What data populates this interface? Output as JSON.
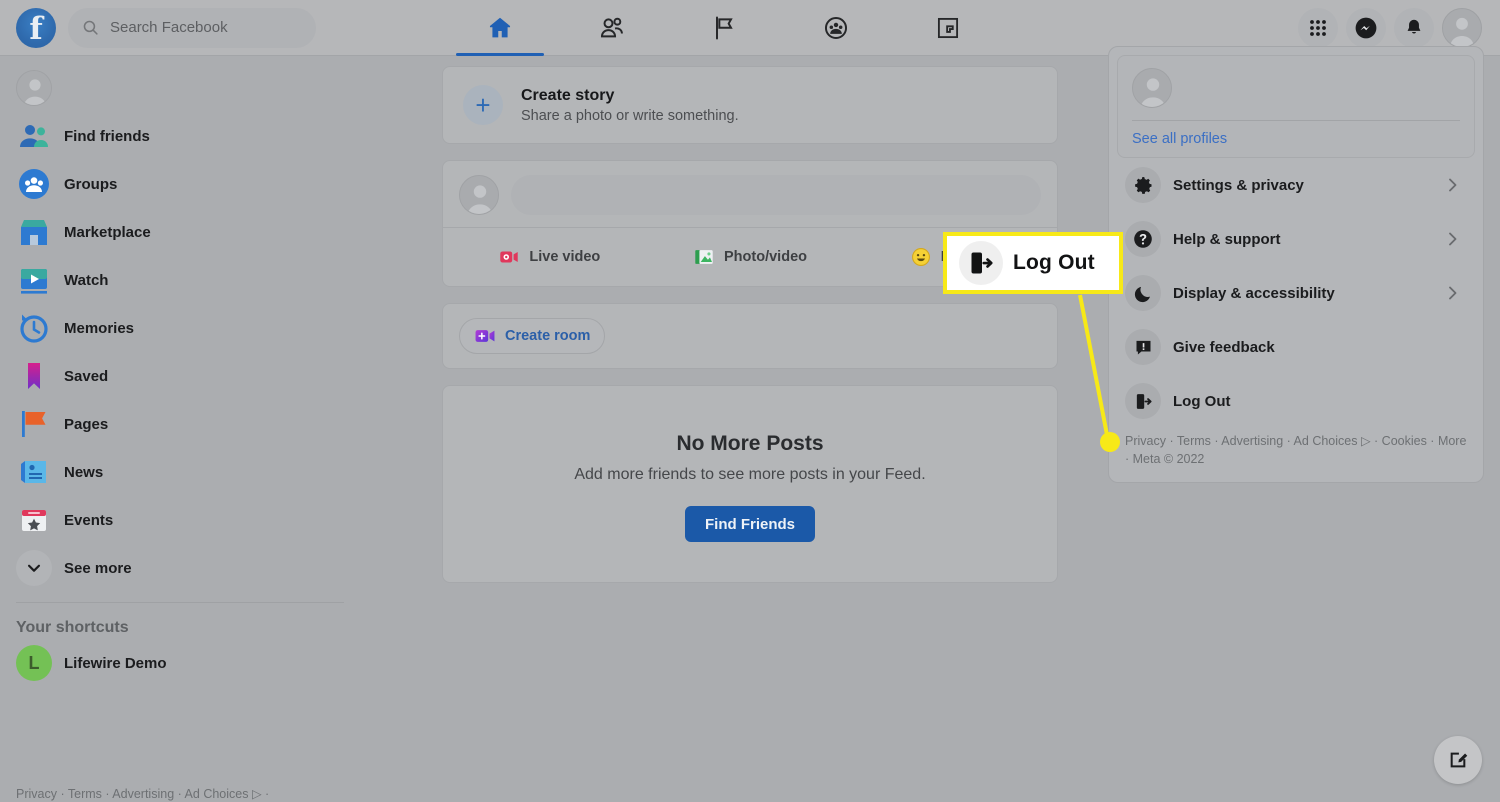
{
  "topbar": {
    "logo_letter": "f",
    "search": {
      "placeholder": "Search Facebook",
      "value": "",
      "icon": "search-icon"
    },
    "nav_tabs": [
      {
        "name": "home",
        "icon": "home-icon",
        "active": true
      },
      {
        "name": "friends",
        "icon": "friends-icon",
        "active": false
      },
      {
        "name": "pages",
        "icon": "flag-icon",
        "active": false
      },
      {
        "name": "groups",
        "icon": "groups-icon",
        "active": false
      },
      {
        "name": "gaming",
        "icon": "gaming-icon",
        "active": false
      }
    ],
    "right_buttons": [
      {
        "name": "menu-grid",
        "icon": "grid-icon"
      },
      {
        "name": "messenger",
        "icon": "messenger-icon"
      },
      {
        "name": "notifications",
        "icon": "bell-icon"
      },
      {
        "name": "account",
        "icon": "avatar-icon"
      }
    ]
  },
  "sidebar": {
    "profile": {
      "label": "",
      "icon": "avatar-icon"
    },
    "items": [
      {
        "label": "Find friends",
        "icon": "find-friends-icon"
      },
      {
        "label": "Groups",
        "icon": "groups-icon"
      },
      {
        "label": "Marketplace",
        "icon": "marketplace-icon"
      },
      {
        "label": "Watch",
        "icon": "watch-icon"
      },
      {
        "label": "Memories",
        "icon": "memories-icon"
      },
      {
        "label": "Saved",
        "icon": "saved-icon"
      },
      {
        "label": "Pages",
        "icon": "pages-icon"
      },
      {
        "label": "News",
        "icon": "news-icon"
      },
      {
        "label": "Events",
        "icon": "events-icon"
      }
    ],
    "see_more": {
      "label": "See more",
      "icon": "chevron-down-icon"
    },
    "shortcuts_title": "Your shortcuts",
    "shortcuts": [
      {
        "label": "Lifewire Demo",
        "initial": "L"
      }
    ],
    "footer": "Privacy · Terms · Advertising · Ad Choices ▷ ·"
  },
  "feed": {
    "create_story": {
      "title": "Create story",
      "subtitle": "Share a photo or write something.",
      "plus": "+"
    },
    "composer": {
      "placeholder": "",
      "actions": [
        {
          "label": "Live video",
          "icon": "live-video-icon"
        },
        {
          "label": "Photo/video",
          "icon": "photo-video-icon"
        },
        {
          "label": "Feeling",
          "icon": "feeling-icon"
        }
      ]
    },
    "create_room": {
      "label": "Create room",
      "icon": "video-room-icon"
    },
    "no_more_posts": {
      "title": "No More Posts",
      "subtitle": "Add more friends to see more posts in your Feed.",
      "button": "Find Friends"
    }
  },
  "account_menu": {
    "profile_card": {
      "name": "",
      "see_all": "See all profiles"
    },
    "items": [
      {
        "label": "Settings & privacy",
        "icon": "gear-icon",
        "has_chevron": true
      },
      {
        "label": "Help & support",
        "icon": "question-icon",
        "has_chevron": true
      },
      {
        "label": "Display & accessibility",
        "icon": "moon-icon",
        "has_chevron": true
      },
      {
        "label": "Give feedback",
        "icon": "feedback-icon",
        "has_chevron": false
      },
      {
        "label": "Log Out",
        "icon": "logout-icon",
        "has_chevron": false
      }
    ],
    "footer": "Privacy · Terms · Advertising · Ad Choices ▷ · Cookies · More · Meta © 2022"
  },
  "callout": {
    "label": "Log Out",
    "icon": "logout-icon",
    "border_color": "#f7e918",
    "background": "#ffffff"
  },
  "fab": {
    "name": "new-message",
    "icon": "compose-icon"
  },
  "colors": {
    "page_background": "#abadb0",
    "card_background": "#b4b6b8",
    "accent_blue": "#1b59a8",
    "link_blue": "#3b6fc4",
    "highlight_yellow": "#f7e918"
  }
}
